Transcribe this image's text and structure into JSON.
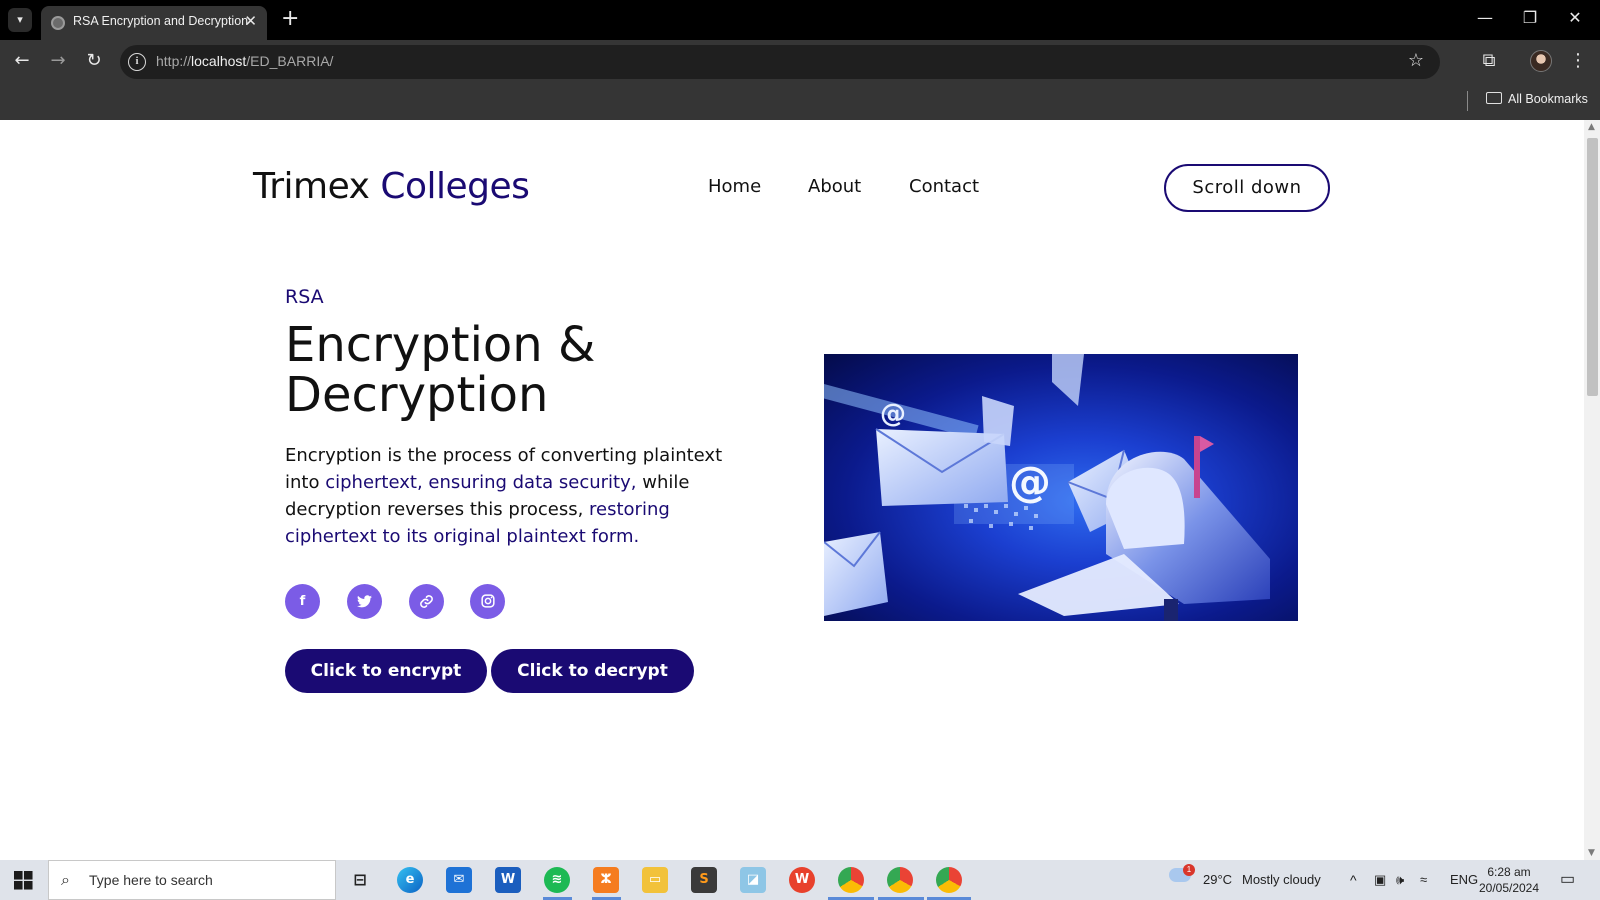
{
  "browser": {
    "tab_title": "RSA Encryption and Decryption",
    "url_scheme": "http://",
    "url_host": "localhost",
    "url_path": "/ED_BARRIA/",
    "bookmarks_label": "All Bookmarks"
  },
  "site": {
    "brand_part1": "Trimex",
    "brand_part2": "Colleges",
    "nav": {
      "home": "Home",
      "about": "About",
      "contact": "Contact"
    },
    "scroll_button": "Scroll down"
  },
  "hero": {
    "kicker": "RSA",
    "title_line1": "Encryption &",
    "title_line2": "Decryption",
    "desc_1": "Encryption is the process of converting plaintext into",
    "desc_2_hl": "ciphertext, ensuring data security,",
    "desc_3": "while decryption reverses this process,",
    "desc_4_hl": "restoring ciphertext to its original plaintext form.",
    "social": [
      "facebook-icon",
      "twitter-icon",
      "link-icon",
      "instagram-icon"
    ],
    "encrypt_button": "Click to encrypt",
    "decrypt_button": "Click to decrypt"
  },
  "taskbar": {
    "search_placeholder": "Type here to search",
    "weather_temp": "29°C",
    "weather_text": "Mostly cloudy",
    "language": "ENG",
    "time": "6:28 am",
    "date": "20/05/2024",
    "weather_alert_count": "1"
  },
  "colors": {
    "accent": "#1a0a73",
    "social_bg": "#7b5ce6",
    "chrome_bg": "#353535"
  }
}
